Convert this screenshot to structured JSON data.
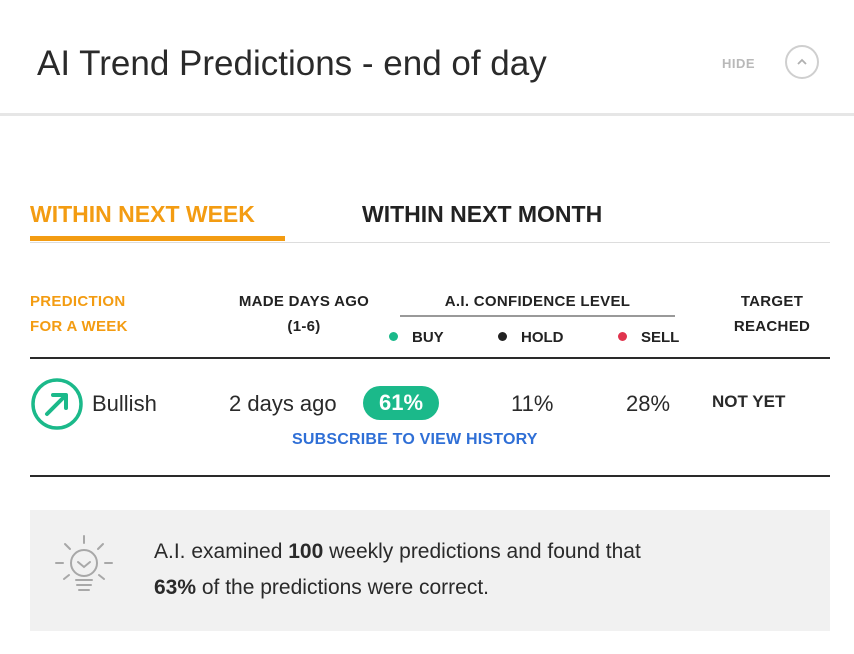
{
  "header": {
    "title": "AI Trend Predictions - end of day",
    "hide_label": "HIDE",
    "collapse_icon": "chevron-up-icon"
  },
  "tabs": [
    {
      "label": "WITHIN NEXT WEEK",
      "active": true
    },
    {
      "label": "WITHIN NEXT MONTH",
      "active": false
    }
  ],
  "columns": {
    "prediction_line1": "PREDICTION",
    "prediction_line2": "FOR A WEEK",
    "made_line1": "MADE DAYS AGO",
    "made_line2": "(1-6)",
    "confidence": "A.I. CONFIDENCE LEVEL",
    "target_line1": "TARGET",
    "target_line2": "REACHED"
  },
  "legend": {
    "buy": "BUY",
    "hold": "HOLD",
    "sell": "SELL"
  },
  "colors": {
    "accent": "#f39c12",
    "buy": "#1bb98a",
    "hold": "#222222",
    "sell": "#e0344e",
    "link": "#2f6fd6"
  },
  "row": {
    "trend_icon": "trend-up-arrow-icon",
    "trend_label": "Bullish",
    "days_ago": "2 days ago",
    "buy": "61%",
    "hold": "11%",
    "sell": "28%",
    "target": "NOT YET"
  },
  "subscribe_link": "SUBSCRIBE TO VIEW HISTORY",
  "insight": {
    "icon": "lightbulb-icon",
    "text_a": "A.I. examined ",
    "count": "100",
    "text_b": " weekly predictions and found that",
    "percent": "63%",
    "text_c": " of the predictions were correct."
  }
}
